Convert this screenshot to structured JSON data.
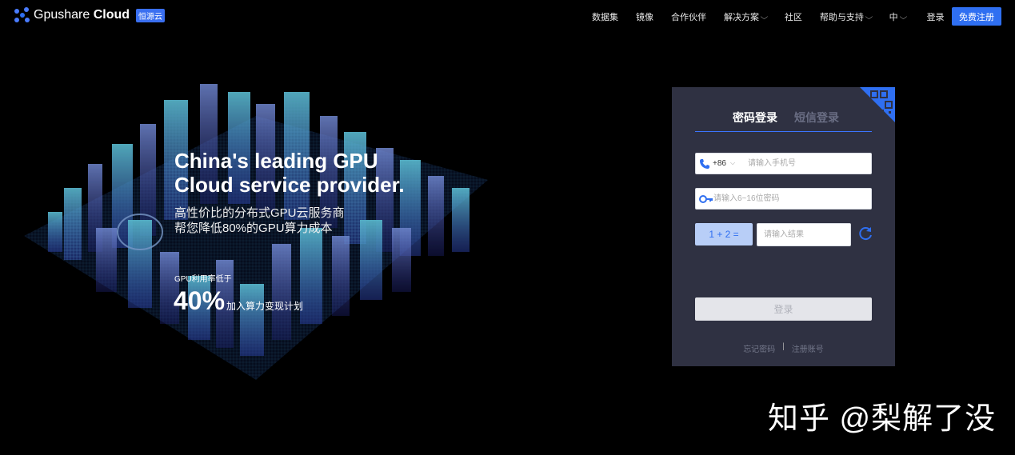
{
  "brand": {
    "name_regular": "Gpushare",
    "name_bold": "Cloud",
    "badge": "恒源云",
    "accent_color": "#2f6ff1"
  },
  "nav": {
    "items": [
      {
        "label": "数据集",
        "dropdown": false
      },
      {
        "label": "镜像",
        "dropdown": false
      },
      {
        "label": "合作伙伴",
        "dropdown": false
      },
      {
        "label": "解决方案",
        "dropdown": true
      },
      {
        "label": "社区",
        "dropdown": false
      },
      {
        "label": "帮助与支持",
        "dropdown": true
      },
      {
        "label": "中",
        "dropdown": true
      },
      {
        "label": "登录",
        "dropdown": false
      }
    ],
    "signup_label": "免费注册"
  },
  "hero": {
    "title_line1": "China's leading GPU",
    "title_line2": "Cloud service provider.",
    "subtitle_line1": "高性价比的分布式GPU云服务商",
    "subtitle_line2": "帮您降低80%的GPU算力成本",
    "stat_label": "GPU利用率低于",
    "stat_value": "40%",
    "stat_desc": "加入算力变现计划"
  },
  "login": {
    "tab_password": "密码登录",
    "tab_sms": "短信登录",
    "country_code": "+86",
    "phone_placeholder": "请输入手机号",
    "password_placeholder": "请输入6~16位密码",
    "captcha_question": "1 + 2 =",
    "captcha_placeholder": "请输入结果",
    "submit_label": "登录",
    "forgot_label": "忘记密码",
    "separator": "|",
    "register_label": "注册账号"
  },
  "watermark": "知乎 @梨解了没",
  "icons": [
    "logo-icon",
    "phone-icon",
    "key-icon",
    "refresh-icon",
    "qr-code-icon",
    "chevron-down-icon"
  ]
}
